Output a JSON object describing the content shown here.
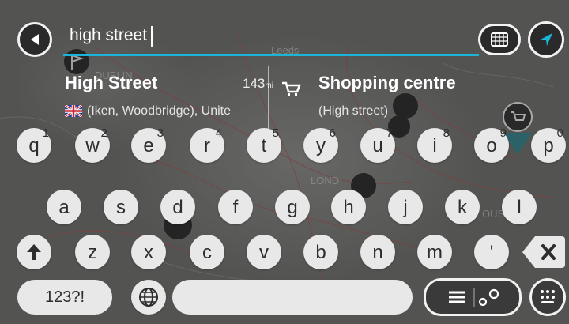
{
  "search": {
    "query": "high street"
  },
  "map_labels": {
    "leeds": "Leeds",
    "dublin": "DUBLIN",
    "london": "LOND",
    "other": "OUS"
  },
  "results": [
    {
      "title": "High Street",
      "distance": "143",
      "distance_unit": "mi",
      "subtitle": "(Iken, Woodbridge), Unite",
      "icon": "uk-flag-icon"
    },
    {
      "title": "Shopping centre",
      "subtitle": "(High street)",
      "icon": "shopping-cart-icon"
    }
  ],
  "keyboard": {
    "row1": [
      {
        "ch": "q",
        "num": "1"
      },
      {
        "ch": "w",
        "num": "2"
      },
      {
        "ch": "e",
        "num": "3"
      },
      {
        "ch": "r",
        "num": "4"
      },
      {
        "ch": "t",
        "num": "5"
      },
      {
        "ch": "y",
        "num": "6"
      },
      {
        "ch": "u",
        "num": "7"
      },
      {
        "ch": "i",
        "num": "8"
      },
      {
        "ch": "o",
        "num": "9"
      },
      {
        "ch": "p",
        "num": "0"
      }
    ],
    "row2": [
      "a",
      "s",
      "d",
      "f",
      "g",
      "h",
      "j",
      "k",
      "l"
    ],
    "row3": [
      "z",
      "x",
      "c",
      "v",
      "b",
      "n",
      "m",
      "'"
    ],
    "symbols_label": "123?!"
  },
  "colors": {
    "accent": "#1bb5d8",
    "key_bg": "#e8e8e8",
    "dark": "#2a2a2a"
  }
}
